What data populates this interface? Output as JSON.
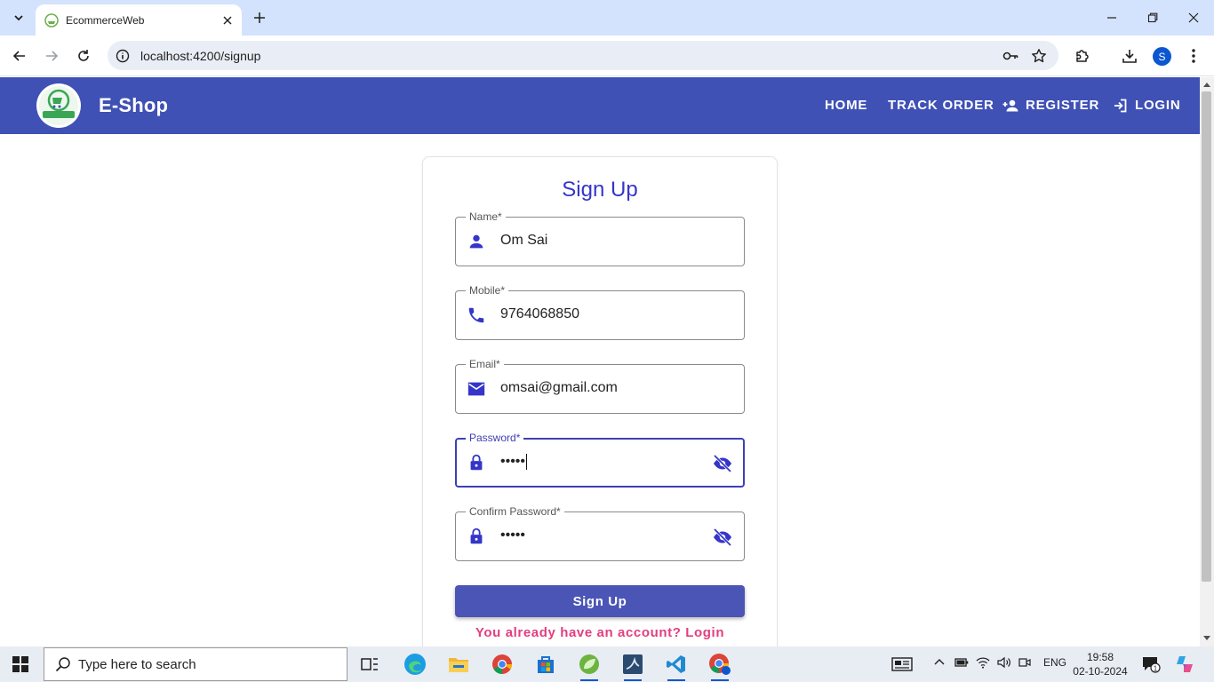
{
  "browser": {
    "tab_title": "EcommerceWeb",
    "url": "localhost:4200/signup",
    "profile_initial": "S"
  },
  "header": {
    "logo_text": "E-SHOP",
    "brand": "E-Shop",
    "nav": {
      "home": "HOME",
      "track_order": "TRACK ORDER",
      "register": "REGISTER",
      "login": "LOGIN"
    }
  },
  "form": {
    "title": "Sign Up",
    "fields": [
      {
        "label": "Name*",
        "value": "Om Sai",
        "icon": "person-icon"
      },
      {
        "label": "Mobile*",
        "value": "9764068850",
        "icon": "phone-icon"
      },
      {
        "label": "Email*",
        "value": "omsai@gmail.com",
        "icon": "mail-icon"
      },
      {
        "label": "Password*",
        "value": "•••••",
        "icon": "lock-icon"
      },
      {
        "label": "Confirm Password*",
        "value": "•••••",
        "icon": "lock-icon"
      }
    ],
    "submit_label": "Sign Up",
    "login_link": "You already have an account? Login"
  },
  "colors": {
    "header_bg": "#3f51b5",
    "title": "#3535c9",
    "link": "#e33e7f",
    "button": "#4a55b5"
  },
  "taskbar": {
    "search_placeholder": "Type here to search",
    "language": "ENG",
    "time": "19:58",
    "date": "02-10-2024",
    "notifications": "1"
  }
}
